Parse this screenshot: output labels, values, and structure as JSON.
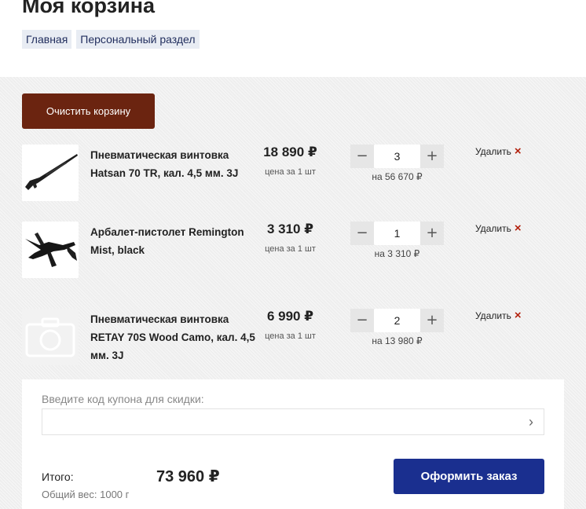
{
  "header": {
    "title": "Моя корзина",
    "breadcrumbs": [
      "Главная",
      "Персональный раздел"
    ]
  },
  "cart": {
    "clear_label": "Очистить корзину",
    "price_note": "цена за 1 шт",
    "remove_label": "Удалить",
    "remove_icon": "×",
    "minus": "−",
    "plus": "+",
    "items": [
      {
        "name": "Пневматическая винтовка Hatsan 70 TR, кал. 4,5 мм. 3J",
        "price": "18 890 ₽",
        "quantity": "3",
        "line_total": "на 56 670 ₽",
        "image": "air-rifle"
      },
      {
        "name": "Арбалет-пистолет Remington Mist, black",
        "price": "3 310 ₽",
        "quantity": "1",
        "line_total": "на 3 310 ₽",
        "image": "pistol-crossbow"
      },
      {
        "name": "Пневматическая винтовка RETAY 70S Wood Camo, кал. 4,5 мм. 3J",
        "price": "6 990 ₽",
        "quantity": "2",
        "line_total": "на 13 980 ₽",
        "image": "placeholder-camera"
      }
    ]
  },
  "summary": {
    "coupon_label": "Введите код купона для скидки:",
    "coupon_value": "",
    "coupon_arrow": "›",
    "total_label": "Итого:",
    "total_value": "73 960 ₽",
    "weight": "Общий вес: 1000 г",
    "order_label": "Оформить заказ"
  },
  "colors": {
    "clear_button": "#6b2410",
    "order_button": "#1a2f8f",
    "remove_icon": "#b2200c",
    "breadcrumb_bg": "#e8ecf3"
  }
}
